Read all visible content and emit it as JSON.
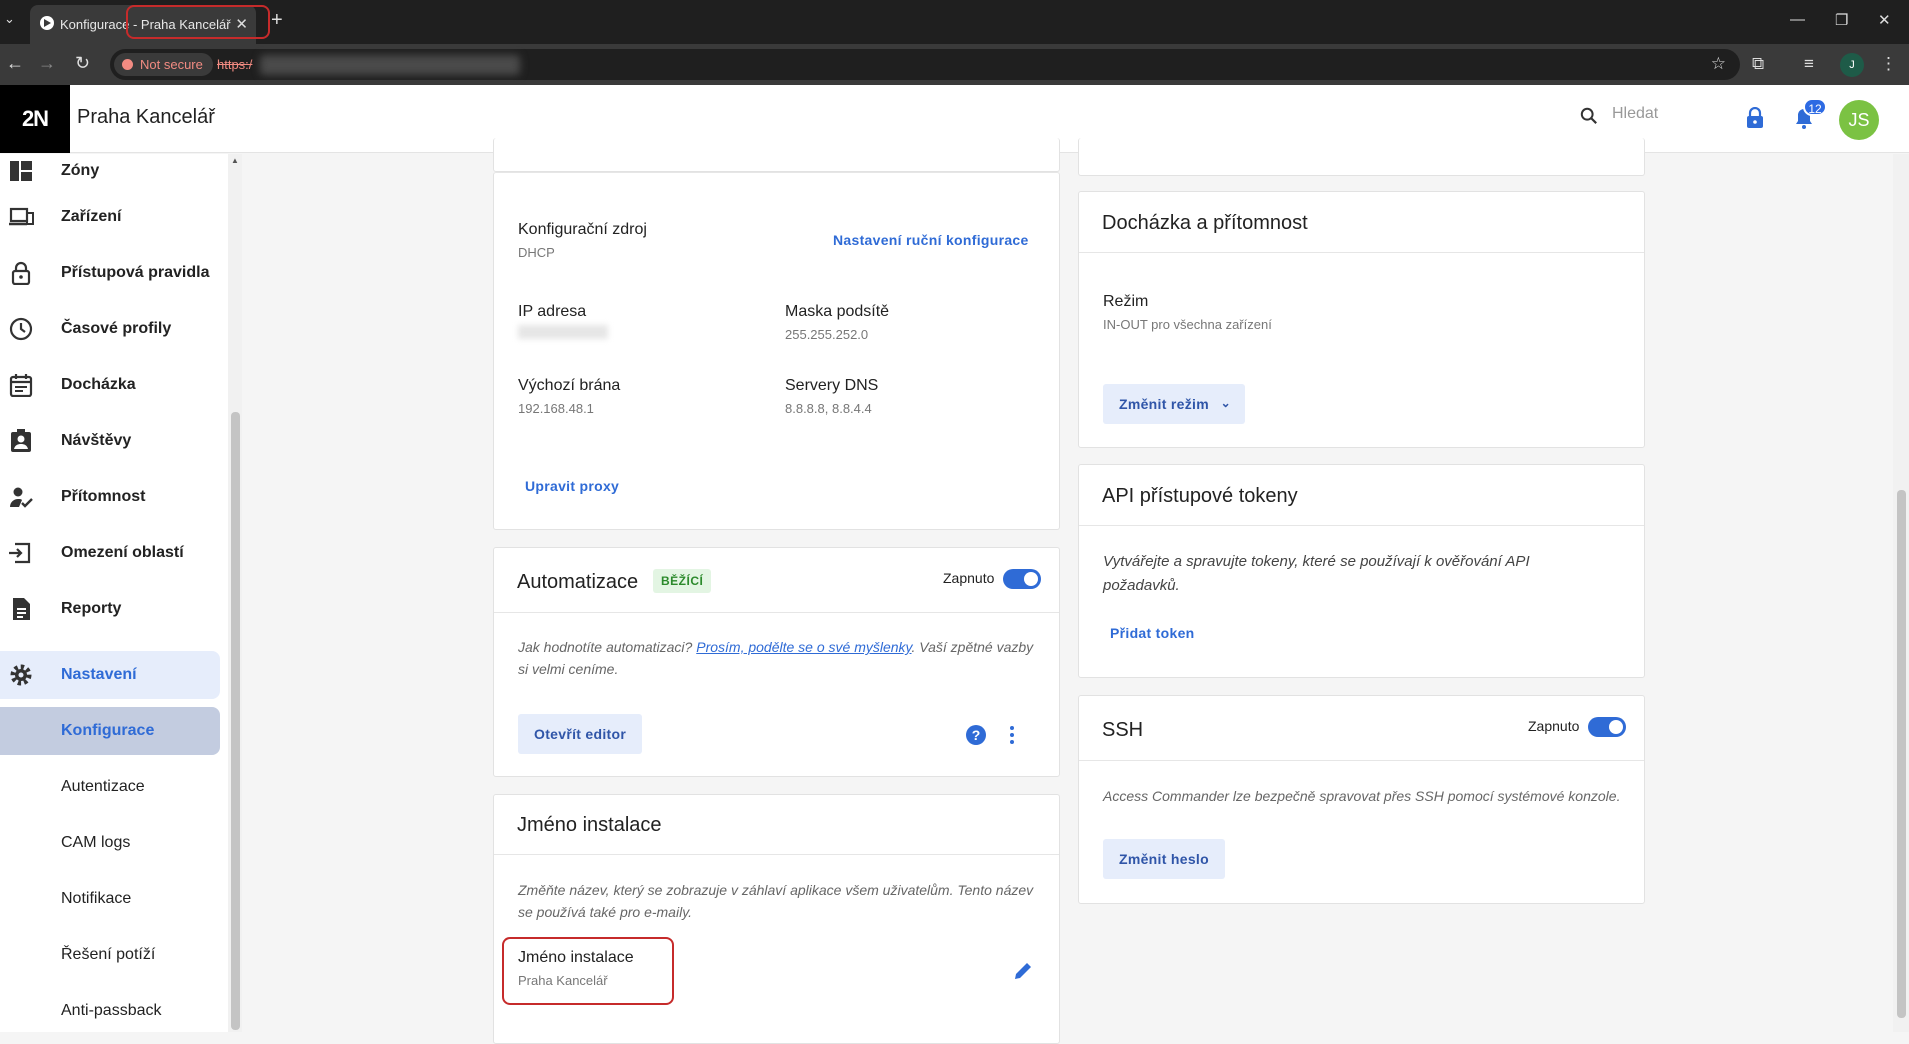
{
  "browser": {
    "tab_title": "Konfigurace - Praha Kancelář",
    "tab_close": "✕",
    "new_tab": "+",
    "tab_list": "⌄",
    "security_label": "Not secure",
    "url_prefix": "https:/",
    "profile_initial": "J",
    "window_controls": [
      "—",
      "❐",
      "✕"
    ]
  },
  "header": {
    "logo": "2N",
    "title": "Praha Kancelář",
    "search_placeholder": "Hledat",
    "notifications_count": "12",
    "user_initials": "JS"
  },
  "sidebar": {
    "items": [
      {
        "label": "Zóny",
        "icon": "zones-icon"
      },
      {
        "label": "Zařízení",
        "icon": "devices-icon"
      },
      {
        "label": "Přístupová pravidla",
        "icon": "lock-icon"
      },
      {
        "label": "Časové profily",
        "icon": "clock-icon"
      },
      {
        "label": "Docházka",
        "icon": "calendar-icon"
      },
      {
        "label": "Návštěvy",
        "icon": "visitor-icon"
      },
      {
        "label": "Přítomnost",
        "icon": "presence-icon"
      },
      {
        "label": "Omezení oblastí",
        "icon": "area-restriction-icon"
      },
      {
        "label": "Reporty",
        "icon": "report-icon"
      },
      {
        "label": "Nastavení",
        "icon": "gear-icon"
      }
    ],
    "subitems": [
      "Konfigurace",
      "Autentizace",
      "CAM logs",
      "Notifikace",
      "Řešení potíží",
      "Anti-passback"
    ]
  },
  "network": {
    "source_label": "Konfigurační zdroj",
    "source_value": "DHCP",
    "manual_link": "Nastavení ruční konfigurace",
    "ip_label": "IP adresa",
    "mask_label": "Maska podsítě",
    "mask_value": "255.255.252.0",
    "gateway_label": "Výchozí brána",
    "gateway_value": "192.168.48.1",
    "dns_label": "Servery DNS",
    "dns_value": "8.8.8.8, 8.8.4.4",
    "proxy_link": "Upravit proxy"
  },
  "automation": {
    "title": "Automatizace",
    "status": "BĚŽÍCÍ",
    "toggle_label": "Zapnuto",
    "toggle_on": true,
    "feedback_prefix": "Jak hodnotíte automatizaci? ",
    "feedback_link": "Prosím, podělte se o své myšlenky",
    "feedback_suffix": ". Vaší zpětné vazby si velmi ceníme.",
    "open_editor": "Otevřít editor"
  },
  "install_name": {
    "title": "Jméno instalace",
    "description": "Změňte název, který se zobrazuje v záhlaví aplikace všem uživatelům. Tento název se používá také pro e-maily.",
    "field_label": "Jméno instalace",
    "field_value": "Praha Kancelář"
  },
  "attendance": {
    "title": "Docházka a přítomnost",
    "mode_label": "Režim",
    "mode_value": "IN-OUT pro všechna zařízení",
    "change_mode": "Změnit režim"
  },
  "api_tokens": {
    "title": "API přístupové tokeny",
    "description": "Vytvářejte a spravujte tokeny, které se používají k ověřování API požadavků.",
    "add_token": "Přidat token"
  },
  "ssh": {
    "title": "SSH",
    "toggle_label": "Zapnuto",
    "toggle_on": true,
    "description": "Access Commander lze bezpečně spravovat přes SSH pomocí systémové konzole.",
    "change_password": "Změnit heslo"
  },
  "colors": {
    "accent": "#2f6bd6",
    "highlight_ring": "#c62b2b",
    "avatar": "#7bc243"
  }
}
